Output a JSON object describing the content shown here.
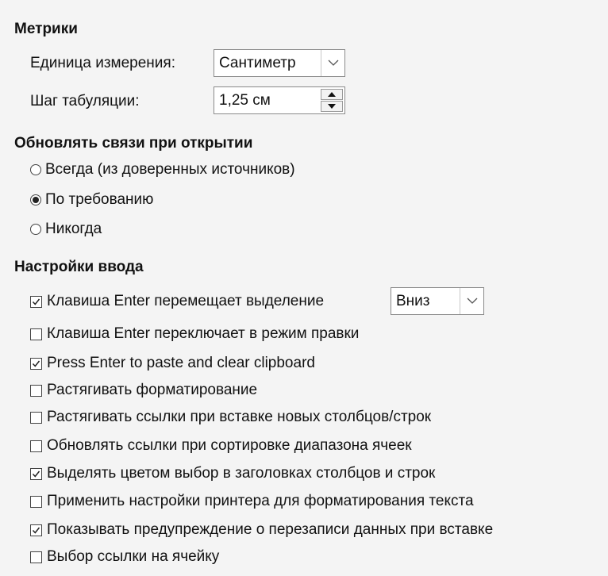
{
  "metrics": {
    "title": "Метрики",
    "unit_label": "Единица измерения:",
    "unit_value": "Сантиметр",
    "tab_label": "Шаг табуляции:",
    "tab_value": "1,25 см"
  },
  "links": {
    "title": "Обновлять связи при открытии",
    "options": [
      {
        "label": "Всегда (из доверенных источников)",
        "selected": false
      },
      {
        "label": "По требованию",
        "selected": true
      },
      {
        "label": "Никогда",
        "selected": false
      }
    ]
  },
  "input": {
    "title": "Настройки ввода",
    "enter_direction": "Вниз",
    "checks": [
      {
        "label": "Клавиша Enter перемещает выделение",
        "checked": true
      },
      {
        "label": "Клавиша Enter переключает в режим правки",
        "checked": false
      },
      {
        "label": "Press Enter to paste and clear clipboard",
        "checked": true
      },
      {
        "label": "Растягивать форматирование",
        "checked": false
      },
      {
        "label": "Растягивать ссылки при вставке новых столбцов/строк",
        "checked": false
      },
      {
        "label": "Обновлять ссылки при сортировке диапазона ячеек",
        "checked": false
      },
      {
        "label": "Выделять цветом выбор в заголовках столбцов и строк",
        "checked": true
      },
      {
        "label": "Применить настройки принтера для форматирования текста",
        "checked": false
      },
      {
        "label": "Показывать предупреждение о перезаписи данных при вставке",
        "checked": true
      },
      {
        "label": "Выбор ссылки на ячейку",
        "checked": false
      }
    ]
  }
}
